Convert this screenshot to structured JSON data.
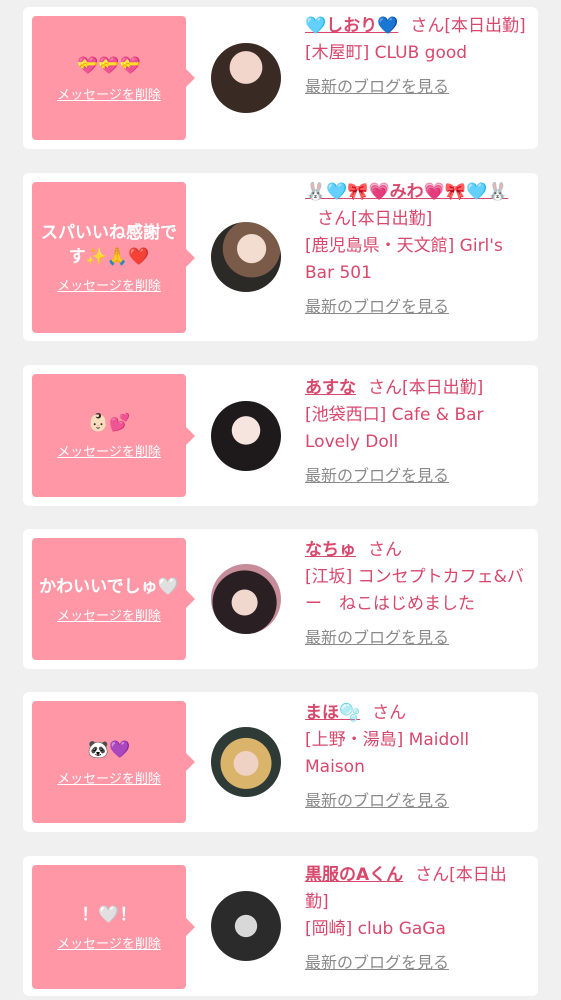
{
  "colors": {
    "accent": "#d8476c",
    "bubble": "#ff97a6",
    "card": "#ffffff",
    "bg": "#f0f0f0",
    "muted": "#8a8a8a"
  },
  "delete_label": "メッセージを削除",
  "blog_label": "最新のブログを見る",
  "items": [
    {
      "message": "💝💝💝",
      "name": "🩵しおり💙",
      "san": "さん",
      "status": "[本日出勤]",
      "shop": "[木屋町] CLUB good"
    },
    {
      "message": "スパいいね感謝です✨🙏❤️",
      "name": "🐰🩵🎀💗みわ💗🎀🩵🐰",
      "san": "さん",
      "status": "[本日出勤]",
      "shop": "[鹿児島県・天文館] Girl's Bar 501"
    },
    {
      "message": "👶🏻💕",
      "name": "あすな",
      "san": "さん",
      "status": "[本日出勤]",
      "shop": "[池袋西口] Cafe & Bar Lovely Doll"
    },
    {
      "message": "かわいいでしゅ🤍",
      "name": "なちゅ",
      "san": "さん",
      "status": "",
      "shop": "[江坂] コンセプトカフェ&バー　ねこはじめました"
    },
    {
      "message": "🐼💜",
      "name": "まほ🫧",
      "san": "さん",
      "status": "",
      "shop": "[上野・湯島] Maidoll Maison"
    },
    {
      "message": "！🤍！",
      "name": "黒服のAくん",
      "san": "さん",
      "status": "[本日出勤]",
      "shop": "[岡崎] club GaGa"
    }
  ]
}
